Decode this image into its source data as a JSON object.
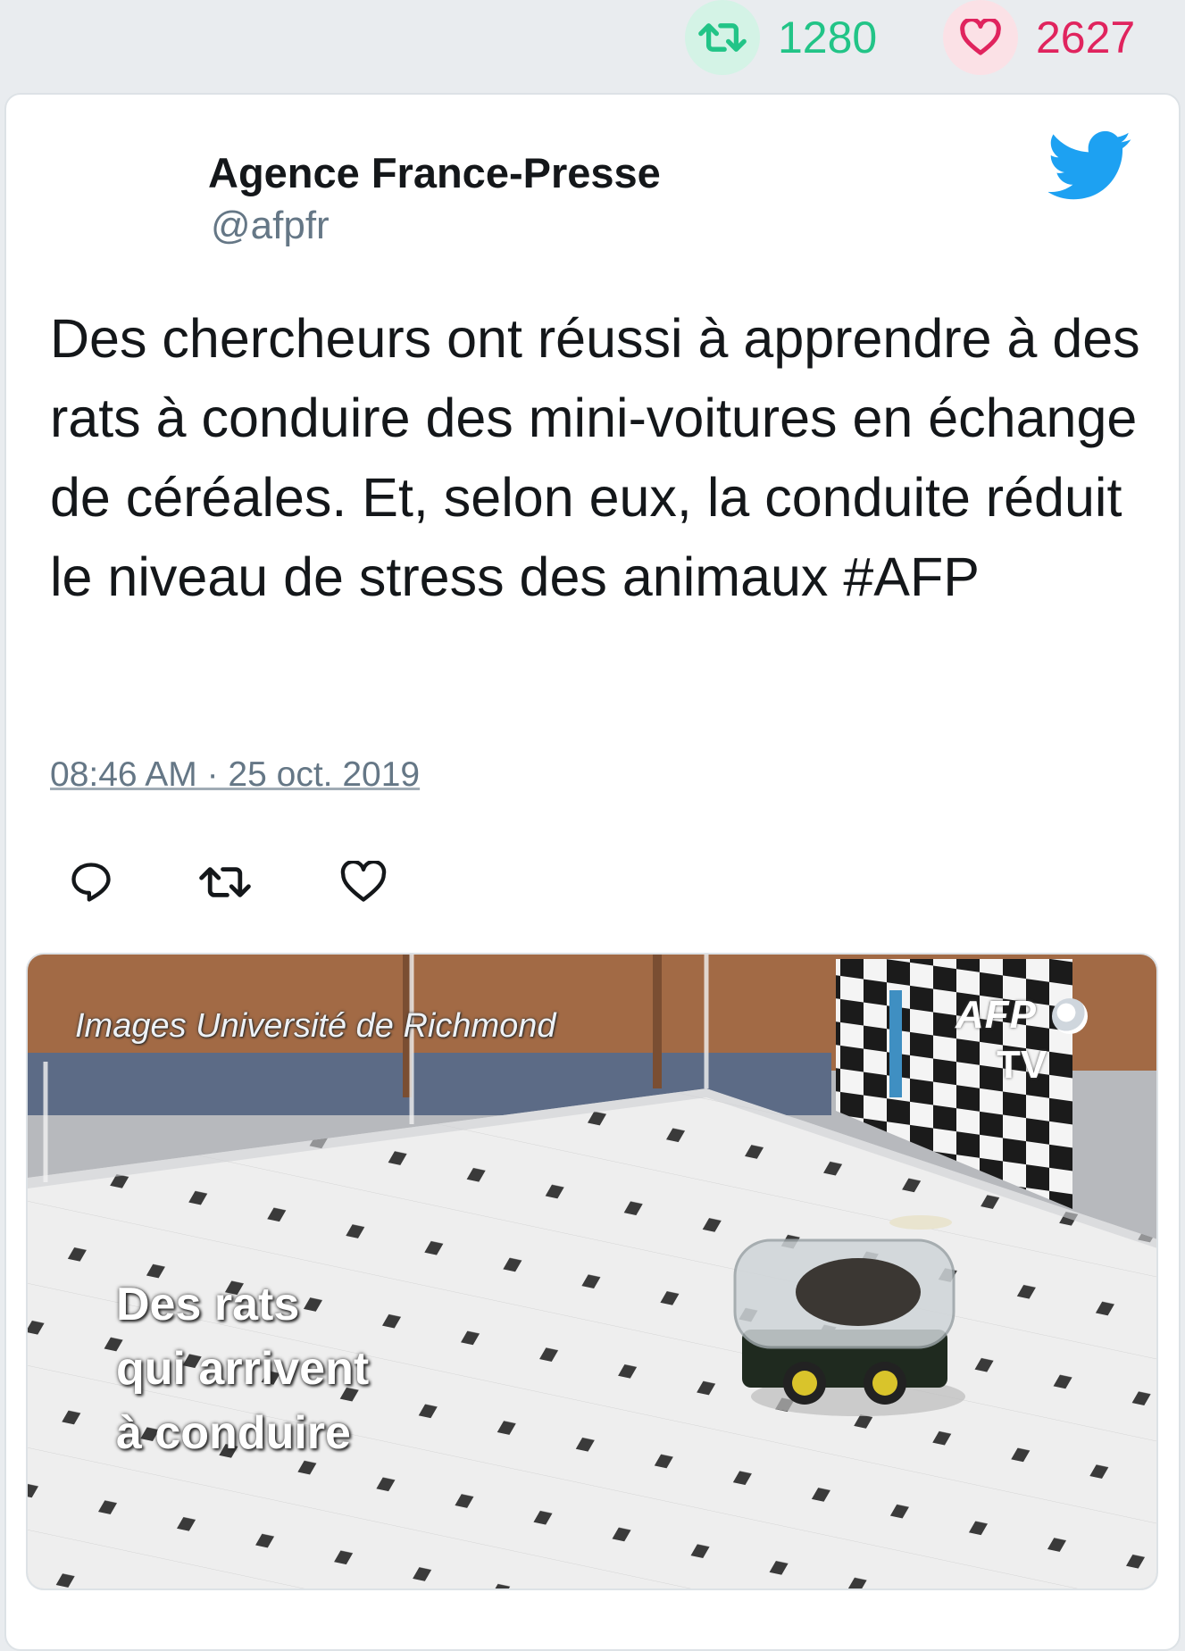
{
  "stats": {
    "retweets": "1280",
    "likes": "2627"
  },
  "tweet": {
    "author_name": "Agence France-Presse",
    "author_handle": "@afpfr",
    "text": "Des chercheurs ont réussi à apprendre à des rats à conduire des mini-voitures en échange de céréales. Et, selon eux, la conduite réduit le niveau de stress des animaux #AFP",
    "timestamp": "08:46 AM · 25 oct. 2019"
  },
  "media": {
    "caption": "Images Université de Richmond",
    "overlay_lines": [
      "Des rats",
      "qui arrivent",
      "à conduire"
    ],
    "logo": {
      "brand": "AFP",
      "suffix": "TV"
    }
  },
  "icons": [
    "retweet-icon",
    "heart-icon",
    "twitter-bird-icon",
    "reply-icon"
  ],
  "colors": {
    "retweet": "#22c487",
    "like": "#e0245e",
    "twitter_blue": "#1da1f2",
    "muted": "#657786"
  }
}
